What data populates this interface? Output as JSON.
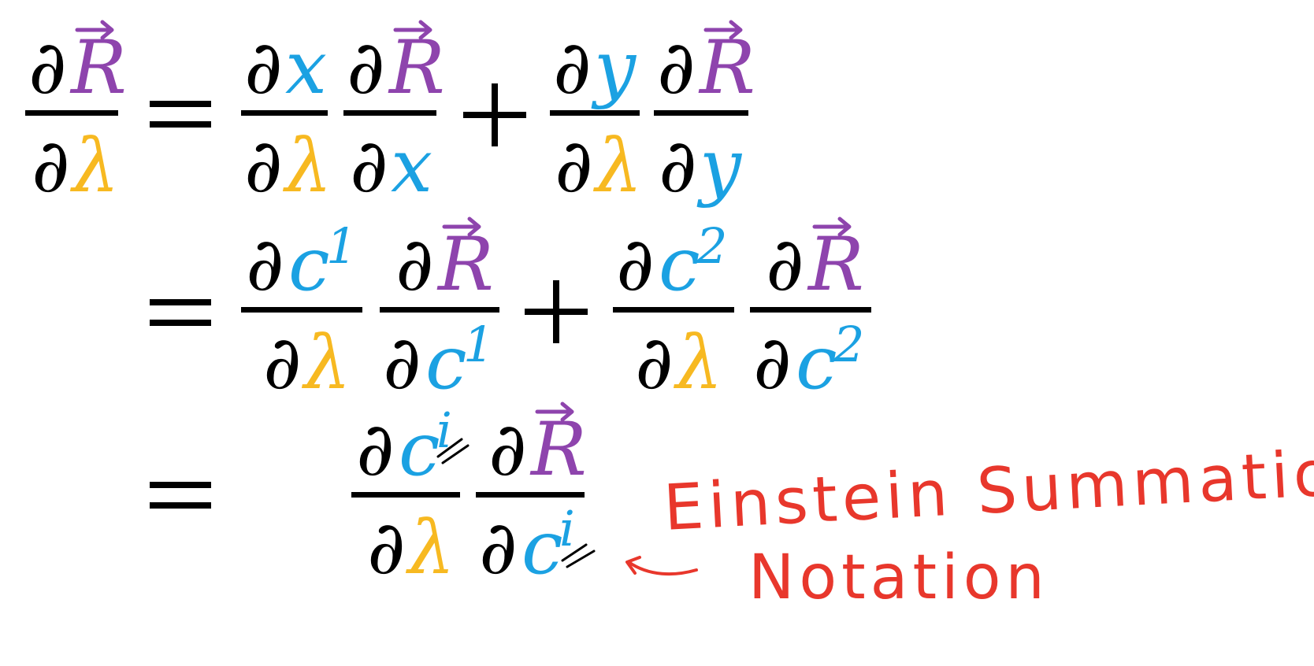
{
  "symbols": {
    "partial": "∂",
    "R": "R",
    "x": "x",
    "y": "y",
    "c": "c",
    "lambda": "λ",
    "one": "1",
    "two": "2",
    "i": "i",
    "equals": "=",
    "plus": "+"
  },
  "colors": {
    "black": "#000000",
    "purple": "#8e44ad",
    "blue": "#1ba1e2",
    "yellow": "#f7b921",
    "red": "#e8372c"
  },
  "annotation": {
    "line1": "Einstein Summation",
    "line2": "Notation"
  }
}
